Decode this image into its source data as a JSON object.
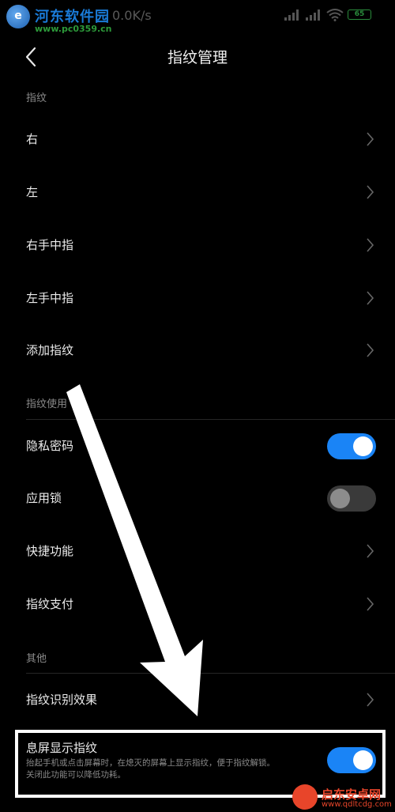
{
  "watermark": {
    "title": "河东软件园",
    "url": "www.pc0359.cn"
  },
  "status_bar": {
    "speed": "0.0K/s",
    "battery": "65"
  },
  "header": {
    "title": "指纹管理"
  },
  "sections": {
    "fingerprints": {
      "label": "指纹"
    },
    "usage": {
      "label": "指纹使用"
    },
    "other": {
      "label": "其他"
    }
  },
  "fingerprint_items": [
    {
      "label": "右"
    },
    {
      "label": "左"
    },
    {
      "label": "右手中指"
    },
    {
      "label": "左手中指"
    },
    {
      "label": "添加指纹"
    }
  ],
  "usage_items": {
    "privacy_password": {
      "label": "隐私密码",
      "enabled": true
    },
    "app_lock": {
      "label": "应用锁",
      "enabled": false
    },
    "shortcuts": {
      "label": "快捷功能"
    },
    "payment": {
      "label": "指纹支付"
    }
  },
  "other_items": {
    "recognition_effect": {
      "label": "指纹识别效果"
    },
    "screen_off_display": {
      "label": "息屏显示指纹",
      "desc_line1": "抬起手机或点击屏幕时，在熄灭的屏幕上显示指纹，便于指纹解锁。",
      "desc_line2": "关闭此功能可以降低功耗。",
      "enabled": true
    }
  },
  "brand": {
    "name": "启东安卓网",
    "url": "www.qdltcdg.com"
  },
  "colors": {
    "accent": "#1a84f6",
    "background": "#000000"
  }
}
